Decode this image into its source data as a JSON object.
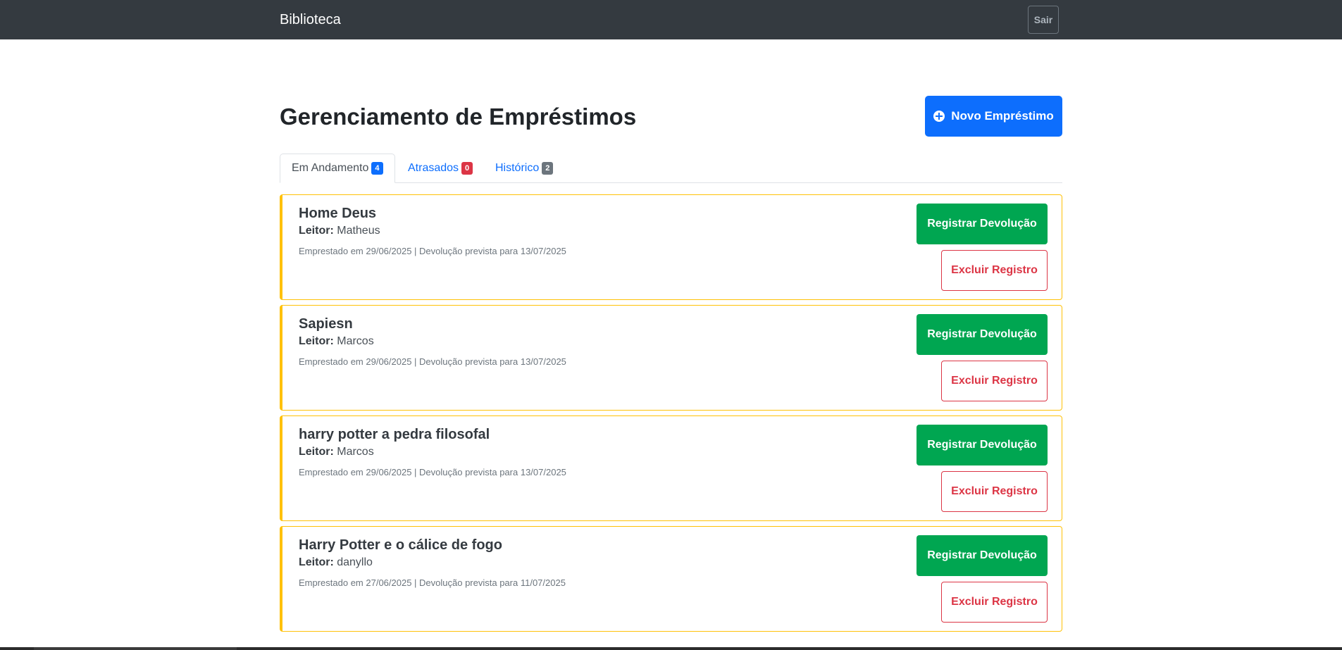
{
  "navbar": {
    "brand": "Biblioteca",
    "logout_label": "Sair"
  },
  "header": {
    "title": "Gerenciamento de Empréstimos",
    "new_loan_label": "Novo Empréstimo"
  },
  "tabs": [
    {
      "label": "Em Andamento",
      "count": "4",
      "active": true,
      "badge_color": "#0d6efd"
    },
    {
      "label": "Atrasados",
      "count": "0",
      "active": false,
      "badge_color": "#dc3545"
    },
    {
      "label": "Histórico",
      "count": "2",
      "active": false,
      "badge_color": "#6c757d"
    }
  ],
  "labels": {
    "reader": "Leitor:",
    "return_button": "Registrar Devolução",
    "delete_button": "Excluir Registro"
  },
  "loans": [
    {
      "title": "Home Deus",
      "reader": "Matheus",
      "dates": "Emprestado em 29/06/2025 | Devolução prevista para 13/07/2025"
    },
    {
      "title": "Sapiesn",
      "reader": "Marcos",
      "dates": "Emprestado em 29/06/2025 | Devolução prevista para 13/07/2025"
    },
    {
      "title": "harry potter a pedra filosofal",
      "reader": "Marcos",
      "dates": "Emprestado em 29/06/2025 | Devolução prevista para 13/07/2025"
    },
    {
      "title": "Harry Potter e o cálice de fogo",
      "reader": "danyllo",
      "dates": "Emprestado em 27/06/2025 | Devolução prevista para 11/07/2025"
    }
  ],
  "colors": {
    "navbar": "#343a40",
    "primary": "#0d6efd",
    "success": "#00a651",
    "danger": "#dc3545",
    "warning_border": "#ffc107"
  }
}
